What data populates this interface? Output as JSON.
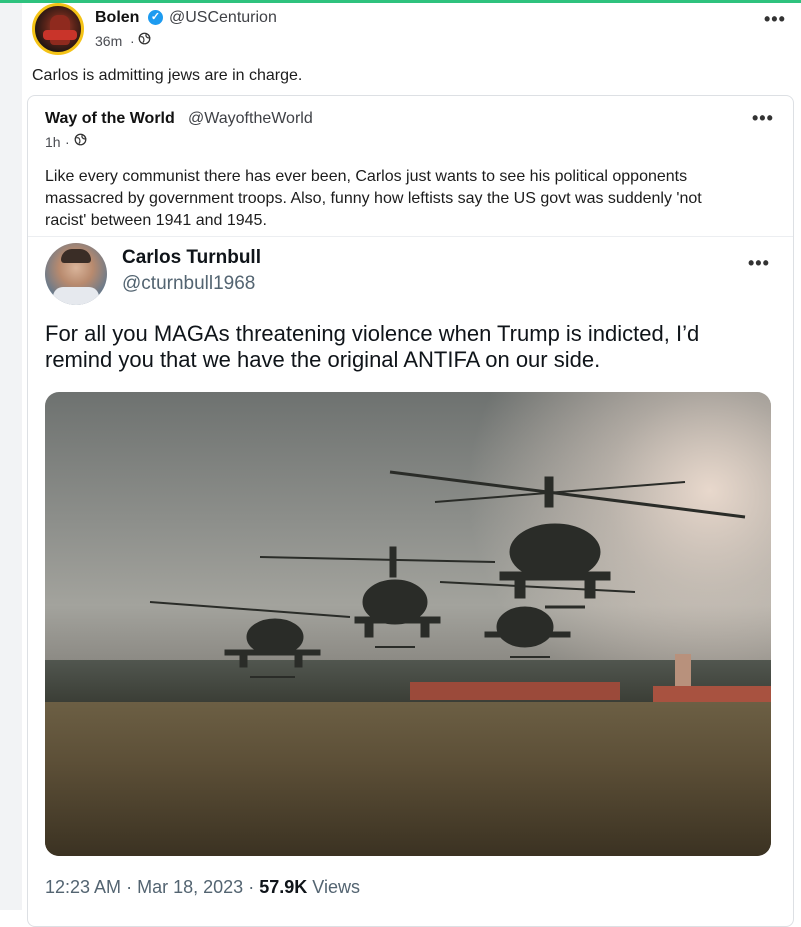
{
  "post": {
    "author_name": "Bolen",
    "verified_icon": "✓",
    "author_handle": "@USCenturion",
    "time": "36m",
    "separator": "·",
    "globe_icon": "globe-icon",
    "text": "Carlos is admitting jews are in charge.",
    "menu": "•••"
  },
  "shared": {
    "author_name": "Way of the World",
    "author_handle": "@WayoftheWorld",
    "time": "1h",
    "separator": "·",
    "text": "Like every communist there has ever been, Carlos just wants to see his political opponents massacred by government troops. Also, funny how leftists say the US govt was suddenly 'not racist' between 1941 and 1945.",
    "menu": "•••"
  },
  "tweet": {
    "author_name": "Carlos Turnbull",
    "author_handle": "@cturnbull1968",
    "menu": "•••",
    "text": "For all you MAGAs threatening violence when Trump is indicted, I’d remind you that we have the original ANTIFA on our side.",
    "time": "12:23 AM",
    "separator": "·",
    "date": "Mar 18, 2023",
    "separator2": "·",
    "views_count": "57.9K",
    "views_label": "Views"
  },
  "colors": {
    "accent_line": "#2ec27e",
    "verified": "#1d9bf0",
    "avatar_ring": "#f4c316"
  }
}
